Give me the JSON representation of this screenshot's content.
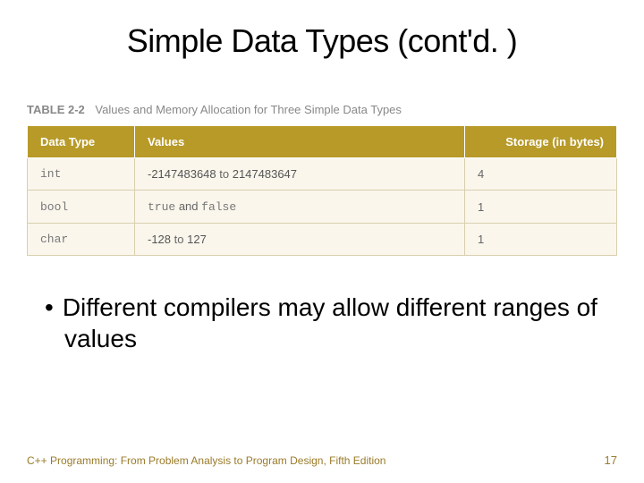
{
  "title": "Simple Data Types (cont'd. )",
  "table": {
    "label": "TABLE 2-2",
    "caption": "Values and Memory Allocation for Three Simple Data Types",
    "headers": {
      "type": "Data Type",
      "values": "Values",
      "storage": "Storage (in bytes)"
    },
    "rows": [
      {
        "type": "int",
        "val_a": "-2147483648",
        "joiner": " to ",
        "val_b": "2147483647",
        "storage": "4"
      },
      {
        "type": "bool",
        "val_a": "true",
        "joiner": " and ",
        "val_b": "false",
        "storage": "1"
      },
      {
        "type": "char",
        "val_a": "-128",
        "joiner": " to ",
        "val_b": "127",
        "storage": "1"
      }
    ]
  },
  "bullet": "Different compilers may allow different ranges of values",
  "footer": {
    "source": "C++ Programming: From Problem Analysis to Program Design, Fifth Edition",
    "page": "17"
  },
  "chart_data": {
    "type": "table",
    "title": "Values and Memory Allocation for Three Simple Data Types",
    "columns": [
      "Data Type",
      "Values",
      "Storage (in bytes)"
    ],
    "rows": [
      [
        "int",
        "-2147483648 to 2147483647",
        4
      ],
      [
        "bool",
        "true and false",
        1
      ],
      [
        "char",
        "-128 to 127",
        1
      ]
    ]
  }
}
